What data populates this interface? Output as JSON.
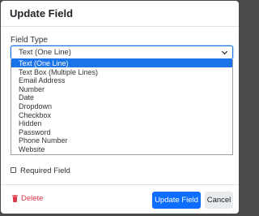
{
  "dialog": {
    "title": "Update Field"
  },
  "field_type": {
    "label": "Field Type",
    "selected": "Text (One Line)",
    "options": [
      "Text (One Line)",
      "Text Box (Multiple Lines)",
      "Email Address",
      "Number",
      "Date",
      "Dropdown",
      "Checkbox",
      "Hidden",
      "Password",
      "Phone Number",
      "Website"
    ]
  },
  "required": {
    "label": "Required Field",
    "checked": false
  },
  "footer": {
    "delete_label": "Delete",
    "update_label": "Update Field",
    "cancel_label": "Cancel"
  },
  "colors": {
    "primary": "#0d6efd",
    "danger": "#dc3545",
    "highlight": "#1a73e8",
    "overlay": "#4a4a4a"
  }
}
